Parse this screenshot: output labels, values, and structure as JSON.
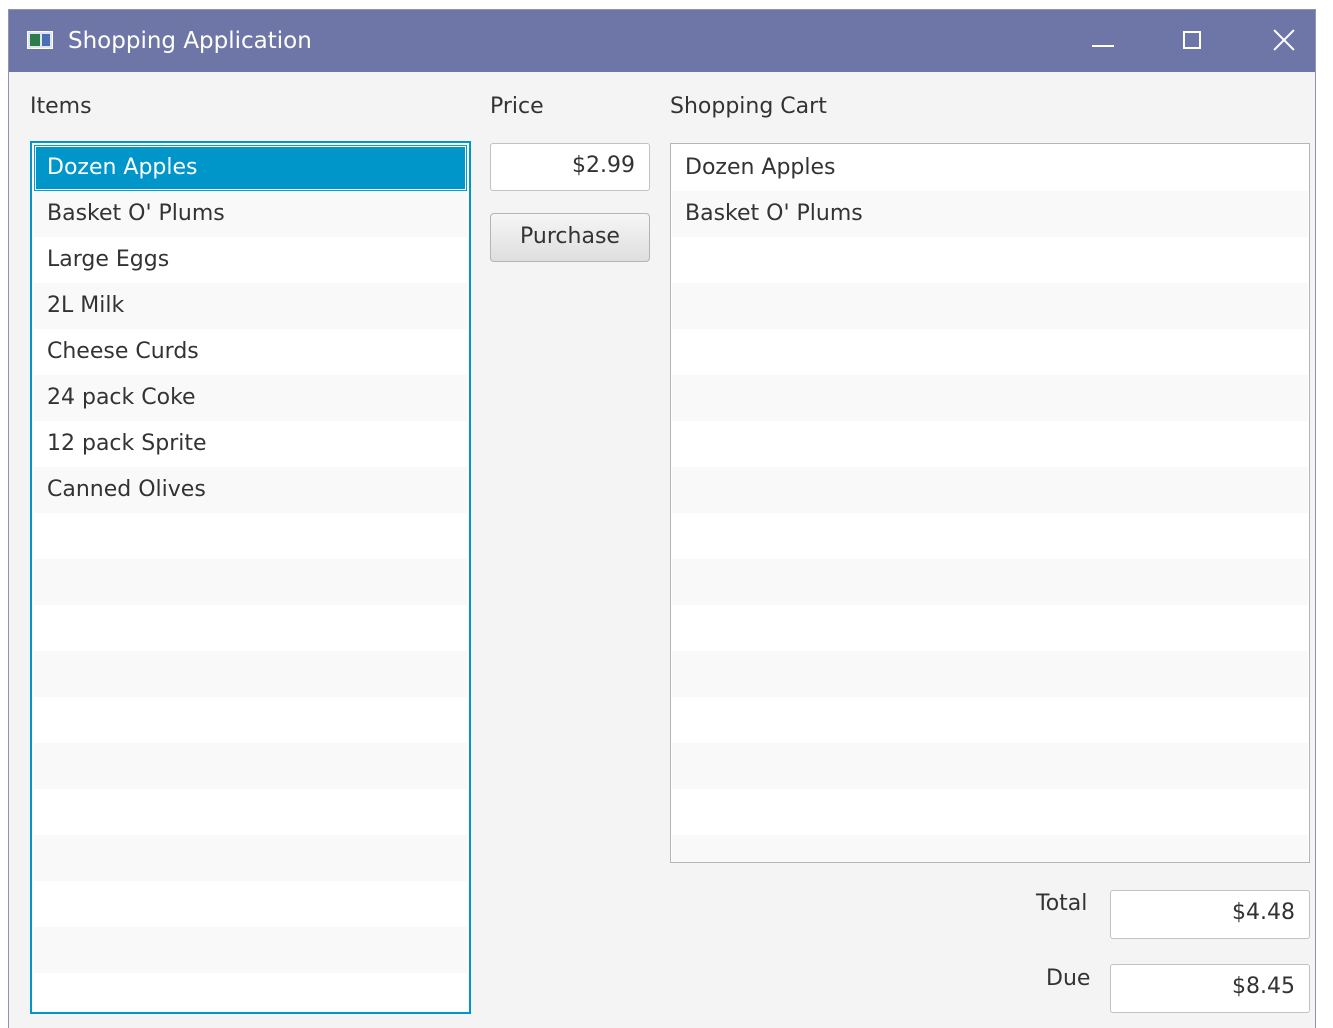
{
  "window": {
    "title": "Shopping Application",
    "controls": {
      "minimize": "minimize-icon",
      "maximize": "maximize-icon",
      "close": "close-icon"
    }
  },
  "items_panel": {
    "label": "Items",
    "selected_index": 0,
    "items": [
      {
        "label": "Dozen Apples"
      },
      {
        "label": "Basket O' Plums"
      },
      {
        "label": "Large Eggs"
      },
      {
        "label": "2L Milk"
      },
      {
        "label": "Cheese Curds"
      },
      {
        "label": "24 pack Coke"
      },
      {
        "label": "12 pack Sprite"
      },
      {
        "label": "Canned Olives"
      }
    ]
  },
  "price_panel": {
    "label": "Price",
    "value": "$2.99",
    "purchase_label": "Purchase"
  },
  "cart_panel": {
    "label": "Shopping Cart",
    "items": [
      {
        "label": "Dozen Apples"
      },
      {
        "label": "Basket O' Plums"
      }
    ]
  },
  "summary": {
    "total_label": "Total",
    "total_value": "$4.48",
    "due_label": "Due",
    "due_value": "$8.45"
  },
  "colors": {
    "titlebar": "#6e76a7",
    "selection": "#0096c9",
    "background": "#f4f4f4"
  }
}
